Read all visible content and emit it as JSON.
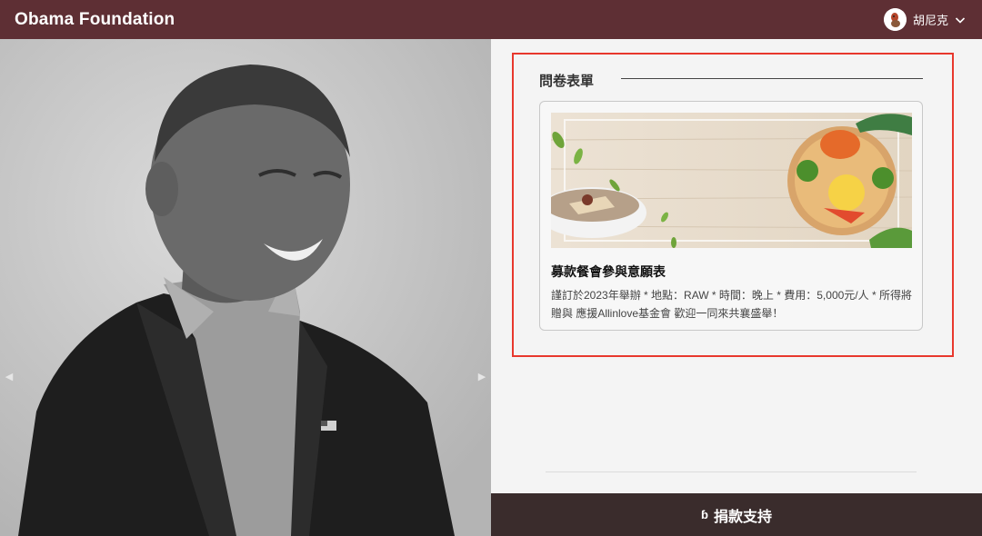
{
  "header": {
    "brand": "Obama Foundation",
    "user_name": "胡尼克"
  },
  "carousel": {
    "prev_icon": "◀",
    "next_icon": "▶"
  },
  "survey": {
    "section_title": "問卷表單",
    "card": {
      "title": "募款餐會參與意願表",
      "description": "謹訂於2023年舉辦 * 地點：RAW * 時間：晚上 * 費用：5,000元/人 * 所得將贈與 應援Allinlove基金會 歡迎一同來共襄盛舉！"
    }
  },
  "donate": {
    "icon": "ɓ",
    "label": "捐款支持"
  },
  "colors": {
    "header_bg": "#5e2f34",
    "highlight_border": "#e8382d",
    "donate_bg": "#3a2c2c"
  }
}
